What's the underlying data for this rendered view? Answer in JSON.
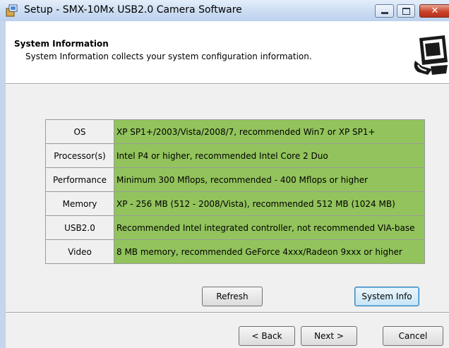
{
  "window": {
    "title": "Setup - SMX-10Mx USB2.0 Camera Software"
  },
  "header": {
    "title": "System Information",
    "subtitle": "System Information collects your system configuration information."
  },
  "table": {
    "rows": [
      {
        "label": "OS",
        "value": "XP SP1+/2003/Vista/2008/7, recommended Win7 or XP SP1+"
      },
      {
        "label": "Processor(s)",
        "value": "Intel P4 or higher, recommended Intel Core 2 Duo"
      },
      {
        "label": "Performance",
        "value": "Minimum 300 Mflops, recommended - 400 Mflops or higher"
      },
      {
        "label": "Memory",
        "value": "XP - 256 MB (512 - 2008/Vista), recommended 512 MB (1024 MB)"
      },
      {
        "label": "USB2.0",
        "value": "Recommended Intel integrated controller, not recommended VIA-base"
      },
      {
        "label": "Video",
        "value": "8 MB memory, recommended GeForce 4xxx/Radeon 9xxx or higher"
      }
    ]
  },
  "buttons": {
    "refresh": "Refresh",
    "system_info": "System Info",
    "back": "< Back",
    "next": "Next >",
    "cancel": "Cancel"
  },
  "colors": {
    "value_cell": "#92c35c",
    "label_cell": "#f0f0f0"
  }
}
